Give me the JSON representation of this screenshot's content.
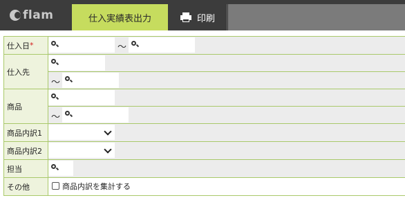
{
  "header": {
    "logo_text": "flam",
    "tabs": [
      {
        "label": "仕入実績表出力",
        "active": true
      },
      {
        "label": "印刷",
        "icon": "printer-icon"
      }
    ]
  },
  "form": {
    "purchase_date": {
      "label": "仕入日",
      "required_mark": "*",
      "range_separator": "～"
    },
    "supplier": {
      "label": "仕入先",
      "range_separator": "～"
    },
    "product": {
      "label": "商品",
      "range_separator": "～"
    },
    "product_breakdown_1": {
      "label": "商品内訳1",
      "selected": ""
    },
    "product_breakdown_2": {
      "label": "商品内訳2",
      "selected": ""
    },
    "person_in_charge": {
      "label": "担当"
    },
    "other": {
      "label": "その他",
      "checkbox_label": "商品内訳を集計する",
      "checked": false
    }
  },
  "colors": {
    "active_tab": "#c6dc5e",
    "header_bg": "#3c3c3c",
    "label_bg": "#eef3dd",
    "border": "#a9c96a",
    "required": "#d41c1c"
  }
}
